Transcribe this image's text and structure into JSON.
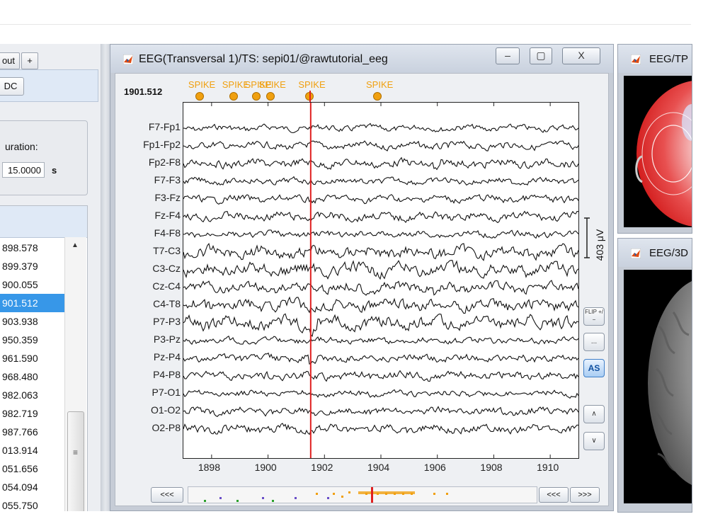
{
  "left_panel": {
    "tabs": [
      "out",
      "+"
    ],
    "dc_label": "DC",
    "duration_label": "uration:",
    "duration_value": "15.0000",
    "duration_unit": "s",
    "event_times": [
      "898.578",
      "899.379",
      "900.055",
      "901.512",
      "903.938",
      "950.359",
      "961.590",
      "968.480",
      "982.063",
      "982.719",
      "987.766",
      "013.914",
      "051.656",
      "054.094",
      "055.750"
    ],
    "selected_index": 3,
    "scroll_up": "▲",
    "scroll_grip": "≡"
  },
  "eeg_window": {
    "title": "EEG(Transversal 1)/TS: sepi01/@rawtutorial_eeg",
    "minimize": "–",
    "restore": "▢",
    "close": "X",
    "current_time": "1901.512",
    "channels": [
      "F7-Fp1",
      "Fp1-Fp2",
      "Fp2-F8",
      "F7-F3",
      "F3-Fz",
      "Fz-F4",
      "F4-F8",
      "T7-C3",
      "C3-Cz",
      "Cz-C4",
      "C4-T8",
      "P7-P3",
      "P3-Pz",
      "Pz-P4",
      "P4-P8",
      "P7-O1",
      "O1-O2",
      "O2-P8"
    ],
    "spike_labels": [
      {
        "text": "SPIKE",
        "t": 1897.6
      },
      {
        "text": "SPIKE",
        "t": 1898.8
      },
      {
        "text": "SPIKE",
        "t": 1899.6
      },
      {
        "text": "SPIKE",
        "t": 1900.1
      },
      {
        "text": "SPIKE",
        "t": 1901.5
      },
      {
        "text": "SPIKE",
        "t": 1903.9
      }
    ],
    "x_ticks": [
      1898,
      1900,
      1902,
      1904,
      1906,
      1908,
      1910
    ],
    "x_range": [
      1897.0,
      1911.0
    ],
    "cursor_time": 1901.512,
    "scale_label": "403 μV",
    "buttons": {
      "flip": "FLIP +/−",
      "more": "...",
      "as": "AS",
      "up": "∧",
      "down": "∨"
    },
    "nav": {
      "back_left": "<<<",
      "back_right": "<<<",
      "forward": ">>>"
    },
    "colors": {
      "trace": "#111111",
      "cursor": "#e02020",
      "spike": "#f0a010"
    }
  },
  "right_windows": [
    {
      "title": "EEG/TP"
    },
    {
      "title": "EEG/3D"
    }
  ]
}
